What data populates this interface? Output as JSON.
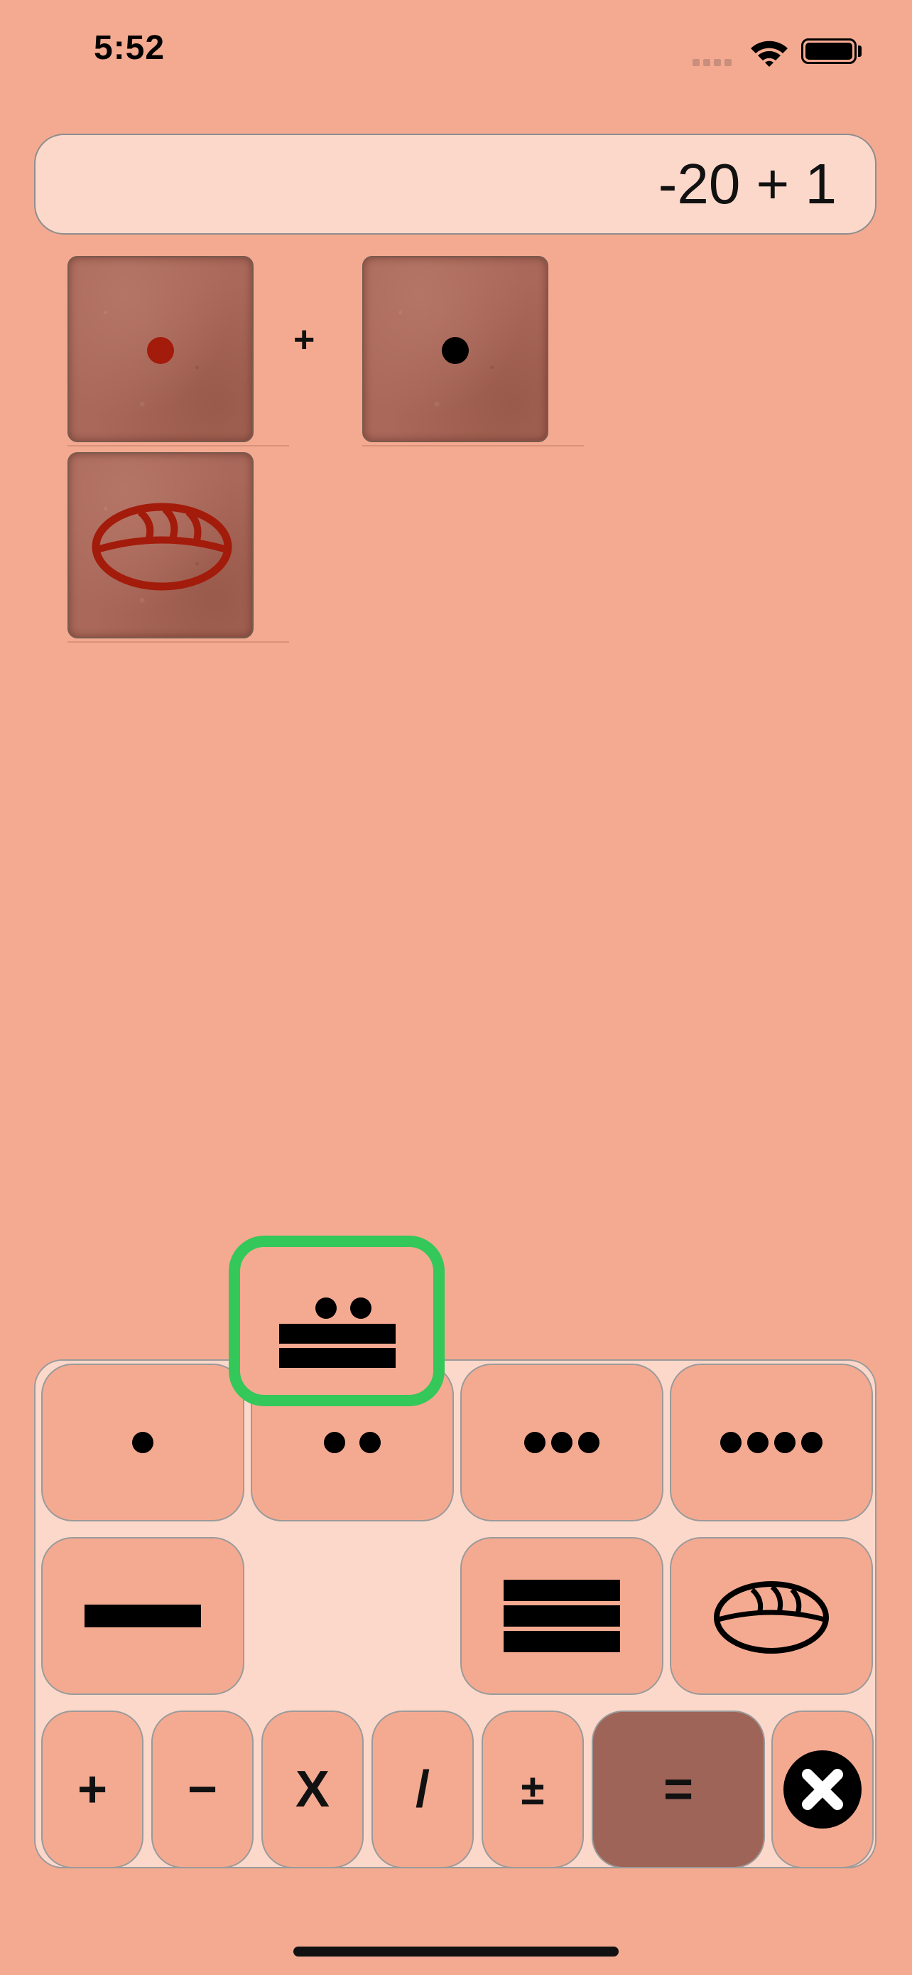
{
  "status_bar": {
    "time": "5:52"
  },
  "display": {
    "value": "-20 + 1"
  },
  "expression": {
    "operator": "+"
  },
  "keypad": {
    "ops": [
      "+",
      "−",
      "X",
      "/",
      "±"
    ],
    "equals": "="
  },
  "colors": {
    "background": "#F4AA91",
    "display_bg": "#FCD8CB",
    "equals_key": "#9E6458",
    "highlight": "#34C759",
    "red_glyph": "#A31B0B"
  }
}
